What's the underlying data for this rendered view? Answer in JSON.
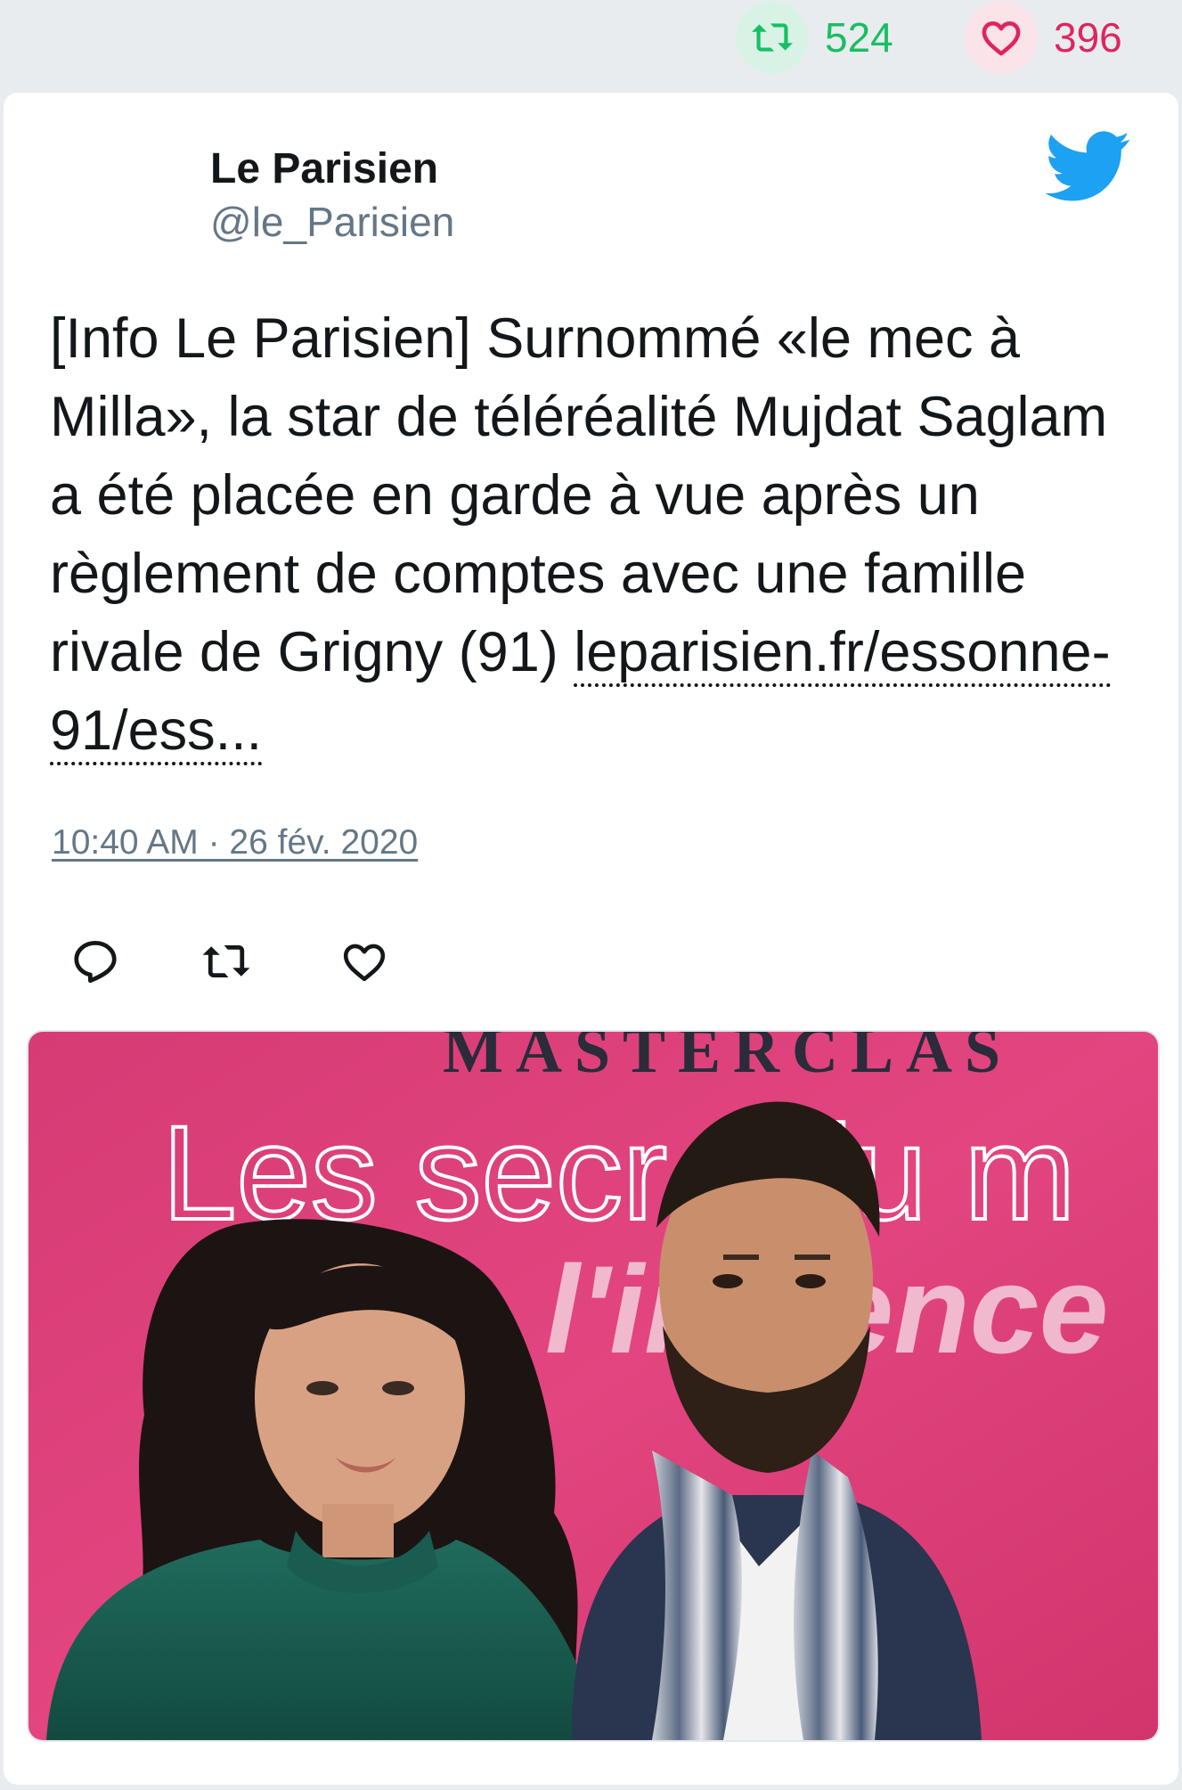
{
  "header_stats": {
    "retweets": "524",
    "likes": "396",
    "retweet_icon": "retweet-icon",
    "like_icon": "heart-icon"
  },
  "tweet": {
    "author_name": "Le Parisien",
    "author_handle": "@le_Parisien",
    "text": "[Info Le Parisien] Surnommé «le mec à Milla», la star de téléréalité Mujdat Saglam a été placée en garde à vue après un règlement de comptes avec une famille rivale de Grigny (91)",
    "link": "leparisien.fr/essonne-91/ess...",
    "timestamp": "10:40 AM · 26 fév. 2020",
    "brand_icon": "twitter-bird-icon"
  },
  "photo": {
    "backdrop_text_1": "MASTERCLAS",
    "backdrop_text_2": "Les secr   du m",
    "backdrop_text_3": "l'in   ence"
  },
  "colors": {
    "retweet_green": "#17bf63",
    "like_red": "#e0245e",
    "twitter_blue": "#1da1f2",
    "muted_gray": "#657786",
    "page_bg": "#e9ecef",
    "backdrop_pink": "#e2457f"
  }
}
